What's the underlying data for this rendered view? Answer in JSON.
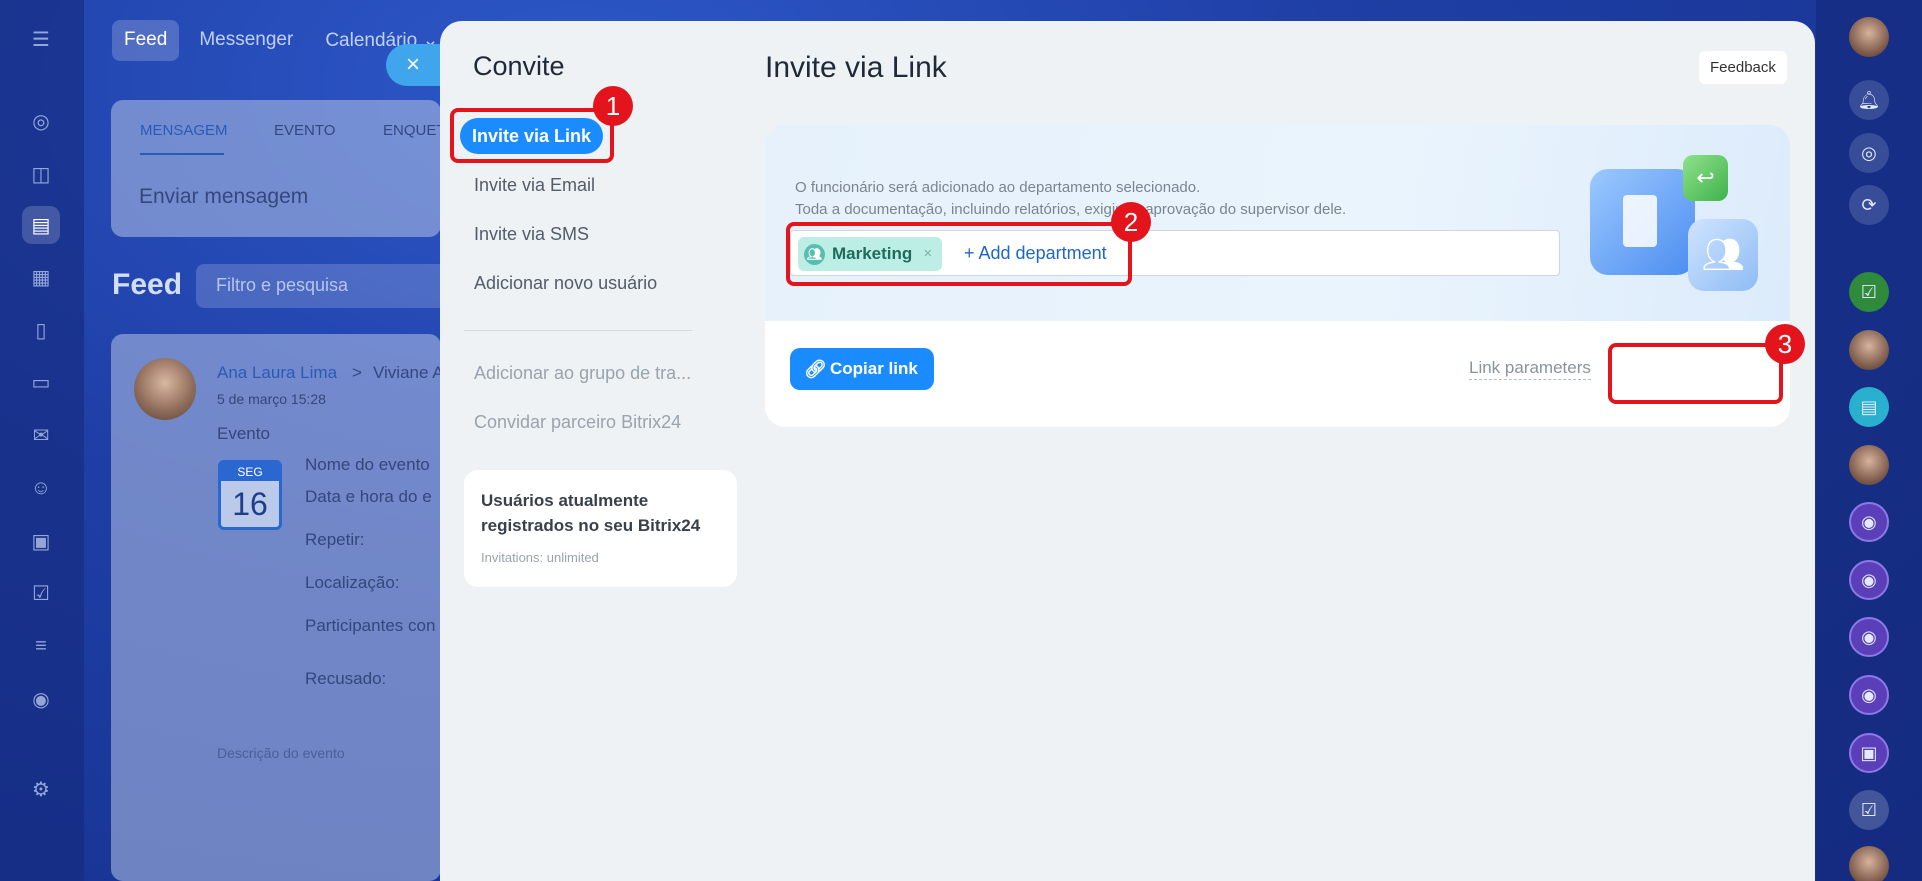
{
  "background": {
    "top_tabs": [
      "Feed",
      "Messenger",
      "Calendário ⌄"
    ],
    "composer_tabs": [
      "MENSAGEM",
      "EVENTO",
      "ENQUET"
    ],
    "composer_placeholder": "Enviar mensagem",
    "feed_title": "Feed",
    "feed_search_placeholder": "Filtro e pesquisa",
    "post": {
      "author": "Ana Laura Lima",
      "arrow": ">",
      "recipient": "Viviane A",
      "datetime": "5 de março 15:28",
      "type": "Evento",
      "calendar_day_abbr": "SEG",
      "calendar_day": "16",
      "fields": [
        "Nome do evento",
        "Data e hora do e",
        "Repetir:",
        "Localização:",
        "Participantes con",
        "Recusado:"
      ],
      "description_label": "Descrição do evento"
    }
  },
  "slider": {
    "close_icon": "×",
    "title": "Convite",
    "menu": [
      {
        "label": "Invite via Link",
        "active": true
      },
      {
        "label": "Invite via Email",
        "active": false
      },
      {
        "label": "Invite via SMS",
        "active": false
      },
      {
        "label": "Adicionar novo usuário",
        "active": false
      }
    ],
    "menu_secondary": [
      {
        "label": "Adicionar ao grupo de tra..."
      },
      {
        "label": "Convidar parceiro Bitrix24"
      }
    ],
    "info_card": {
      "title": "Usuários atualmente registrados no seu Bitrix24",
      "subtitle": "Invitations: unlimited"
    }
  },
  "main": {
    "title": "Invite via Link",
    "feedback_label": "Feedback",
    "description_line1": "O funcionário será adicionado ao departamento selecionado.",
    "description_line2": "Toda a documentação, incluindo relatórios, exigirá a aprovação do supervisor dele.",
    "department_chip": "Marketing",
    "chip_remove": "×",
    "add_department": "+ Add department",
    "copy_link_label": "Copiar link",
    "link_parameters_label": "Link parameters"
  },
  "annotations": [
    "1",
    "2",
    "3"
  ],
  "colors": {
    "accent": "#1a8cff",
    "annotation_red": "#e3141b",
    "chip_bg": "#bdeee6",
    "panel_bg": "#eef2f4"
  }
}
